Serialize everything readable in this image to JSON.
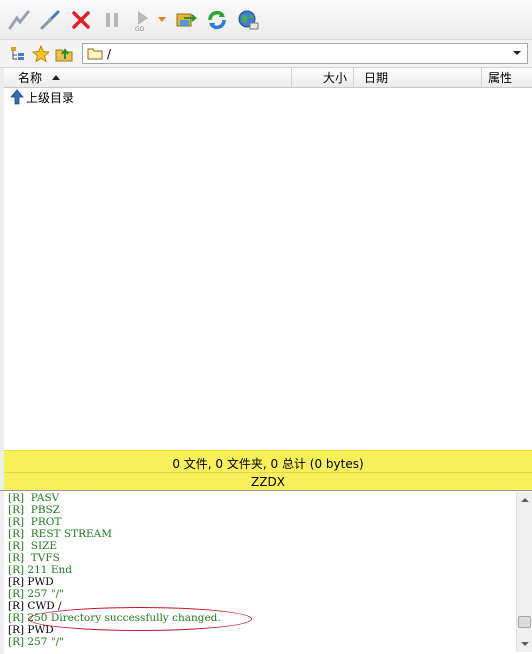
{
  "toolbar": {
    "buttons": [
      {
        "name": "connect-icon"
      },
      {
        "name": "disconnect-icon"
      },
      {
        "name": "stop-icon"
      },
      {
        "name": "pause-icon"
      },
      {
        "name": "play-go-icon"
      },
      {
        "name": "dropdown-arrow-icon"
      },
      {
        "name": "transfer-icon"
      },
      {
        "name": "refresh-icon"
      },
      {
        "name": "globe-icon"
      }
    ]
  },
  "addressbar": {
    "path": "/"
  },
  "columns": {
    "name": "名称",
    "size": "大小",
    "date": "日期",
    "attr": "属性"
  },
  "filelist": {
    "rows": [
      {
        "label": "上级目录",
        "icon": "up-arrow-icon"
      }
    ]
  },
  "status": {
    "summary": "0 文件, 0 文件夹, 0 总计 (0 bytes)",
    "site": "ZZDX"
  },
  "log": {
    "lines": [
      {
        "text": "[R]  PASV",
        "color": "green"
      },
      {
        "text": "[R]  PBSZ",
        "color": "green"
      },
      {
        "text": "[R]  PROT",
        "color": "green"
      },
      {
        "text": "[R]  REST STREAM",
        "color": "green"
      },
      {
        "text": "[R]  SIZE",
        "color": "green"
      },
      {
        "text": "[R]  TVFS",
        "color": "green"
      },
      {
        "text": "[R] 211 End",
        "color": "green"
      },
      {
        "text": "[R] PWD",
        "color": "black"
      },
      {
        "text": "[R] 257 \"/\"",
        "color": "green"
      },
      {
        "text": "[R] CWD /",
        "color": "black"
      },
      {
        "text": "[R] 250 Directory successfully changed.",
        "color": "green"
      },
      {
        "text": "[R] PWD",
        "color": "black"
      },
      {
        "text": "[R] 257 \"/\"",
        "color": "green"
      }
    ]
  },
  "colors": {
    "status_bg": "#f7f05a",
    "log_green": "#1d7a1d",
    "highlight": "#c4162a"
  }
}
